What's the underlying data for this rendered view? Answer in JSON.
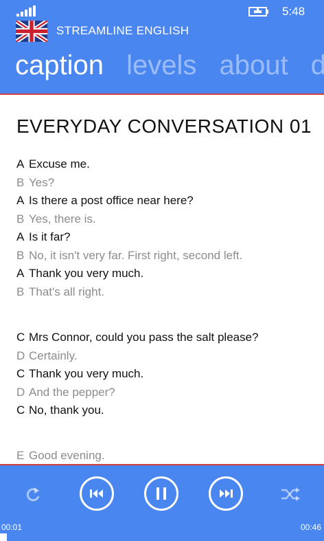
{
  "status_bar": {
    "time": "5:48"
  },
  "app": {
    "title": "STREAMLINE ENGLISH"
  },
  "pivot": {
    "items": [
      "caption",
      "levels",
      "about",
      "de"
    ],
    "active_index": 0
  },
  "lesson": {
    "title": "EVERYDAY CONVERSATION 01",
    "blocks": [
      [
        {
          "speaker": "A",
          "text": "Excuse me."
        },
        {
          "speaker": "B",
          "text": "Yes?"
        },
        {
          "speaker": "A",
          "text": "Is there a post office near here?"
        },
        {
          "speaker": "B",
          "text": "Yes, there is."
        },
        {
          "speaker": "A",
          "text": "Is it far?"
        },
        {
          "speaker": "B",
          "text": "No, it isn't very far. First right, second left."
        },
        {
          "speaker": "A",
          "text": "Thank you very much."
        },
        {
          "speaker": "B",
          "text": "That's all right."
        }
      ],
      [
        {
          "speaker": "C",
          "text": "Mrs Connor, could you pass the salt please?"
        },
        {
          "speaker": "D",
          "text": "Certainly."
        },
        {
          "speaker": "C",
          "text": "Thank you very much."
        },
        {
          "speaker": "D",
          "text": "And the pepper?"
        },
        {
          "speaker": "C",
          "text": "No, thank you."
        }
      ],
      [
        {
          "speaker": "E",
          "text": "Good evening."
        }
      ]
    ]
  },
  "player": {
    "elapsed": "00:01",
    "total": "00:46",
    "progress_fraction": 0.022,
    "buttons": [
      "repeat-icon",
      "previous-icon",
      "pause-icon",
      "next-icon",
      "shuffle-icon"
    ]
  },
  "colors": {
    "accent": "#4A86F0",
    "separator": "#d93a3a",
    "dark_text": "#111111",
    "grey_text": "#8c8c8c"
  }
}
